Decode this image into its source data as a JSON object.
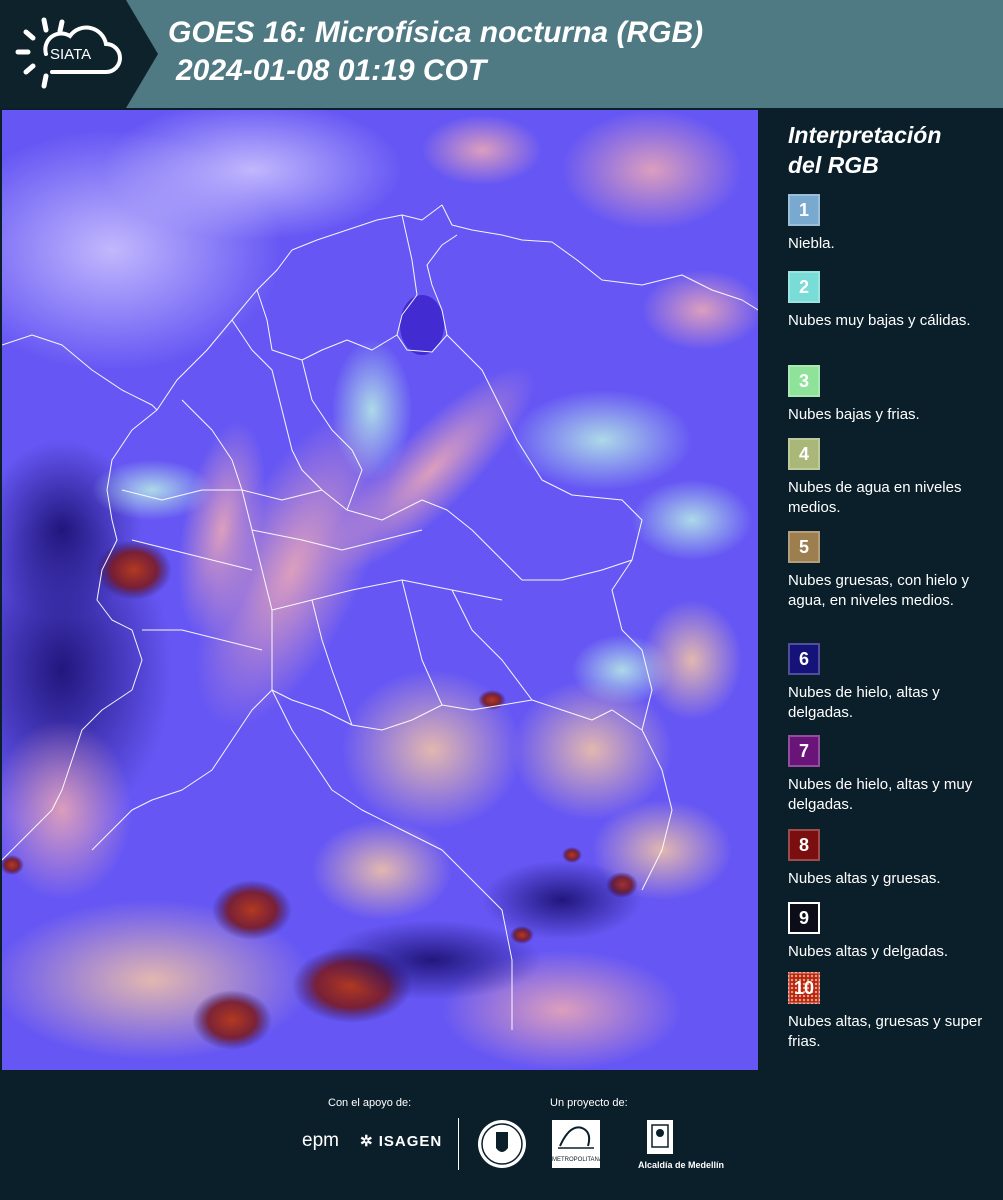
{
  "header": {
    "logo_text": "SIATA",
    "title_line1": "GOES 16: Microfísica nocturna (RGB)",
    "title_line2": "2024-01-08 01:19 COT"
  },
  "legend": {
    "title_line1": "Interpretación",
    "title_line2": "del RGB",
    "items": [
      {
        "number": "1",
        "label": "Niebla.",
        "color": "#7aa9cf"
      },
      {
        "number": "2",
        "label": "Nubes muy bajas y cálidas.",
        "color": "#79dcd6"
      },
      {
        "number": "3",
        "label": "Nubes bajas y frias.",
        "color": "#8fe29a"
      },
      {
        "number": "4",
        "label": "Nubes de agua en niveles medios.",
        "color": "#a9b879"
      },
      {
        "number": "5",
        "label": "Nubes gruesas, con hielo y agua, en niveles medios.",
        "color": "#9c7e4f"
      },
      {
        "number": "6",
        "label": "Nubes de hielo, altas y delgadas.",
        "color": "#15137a"
      },
      {
        "number": "7",
        "label": "Nubes de hielo, altas y muy delgadas.",
        "color": "#6a1479"
      },
      {
        "number": "8",
        "label": "Nubes altas y gruesas.",
        "color": "#7b0f0f"
      },
      {
        "number": "9",
        "label": "Nubes altas y delgadas.",
        "color": "#0d0d1a"
      },
      {
        "number": "10",
        "label": "Nubes altas, gruesas y super frias.",
        "color": "#b3241a"
      }
    ]
  },
  "footer": {
    "support_label": "Con el apoyo de:",
    "project_label": "Un proyecto de:",
    "sponsor1": "epm",
    "sponsor2": "ISAGEN",
    "partner1": "Área Metropolitana",
    "partner1_sub": "METROPOLITANA",
    "partner2": "Alcaldía de Medellín"
  }
}
